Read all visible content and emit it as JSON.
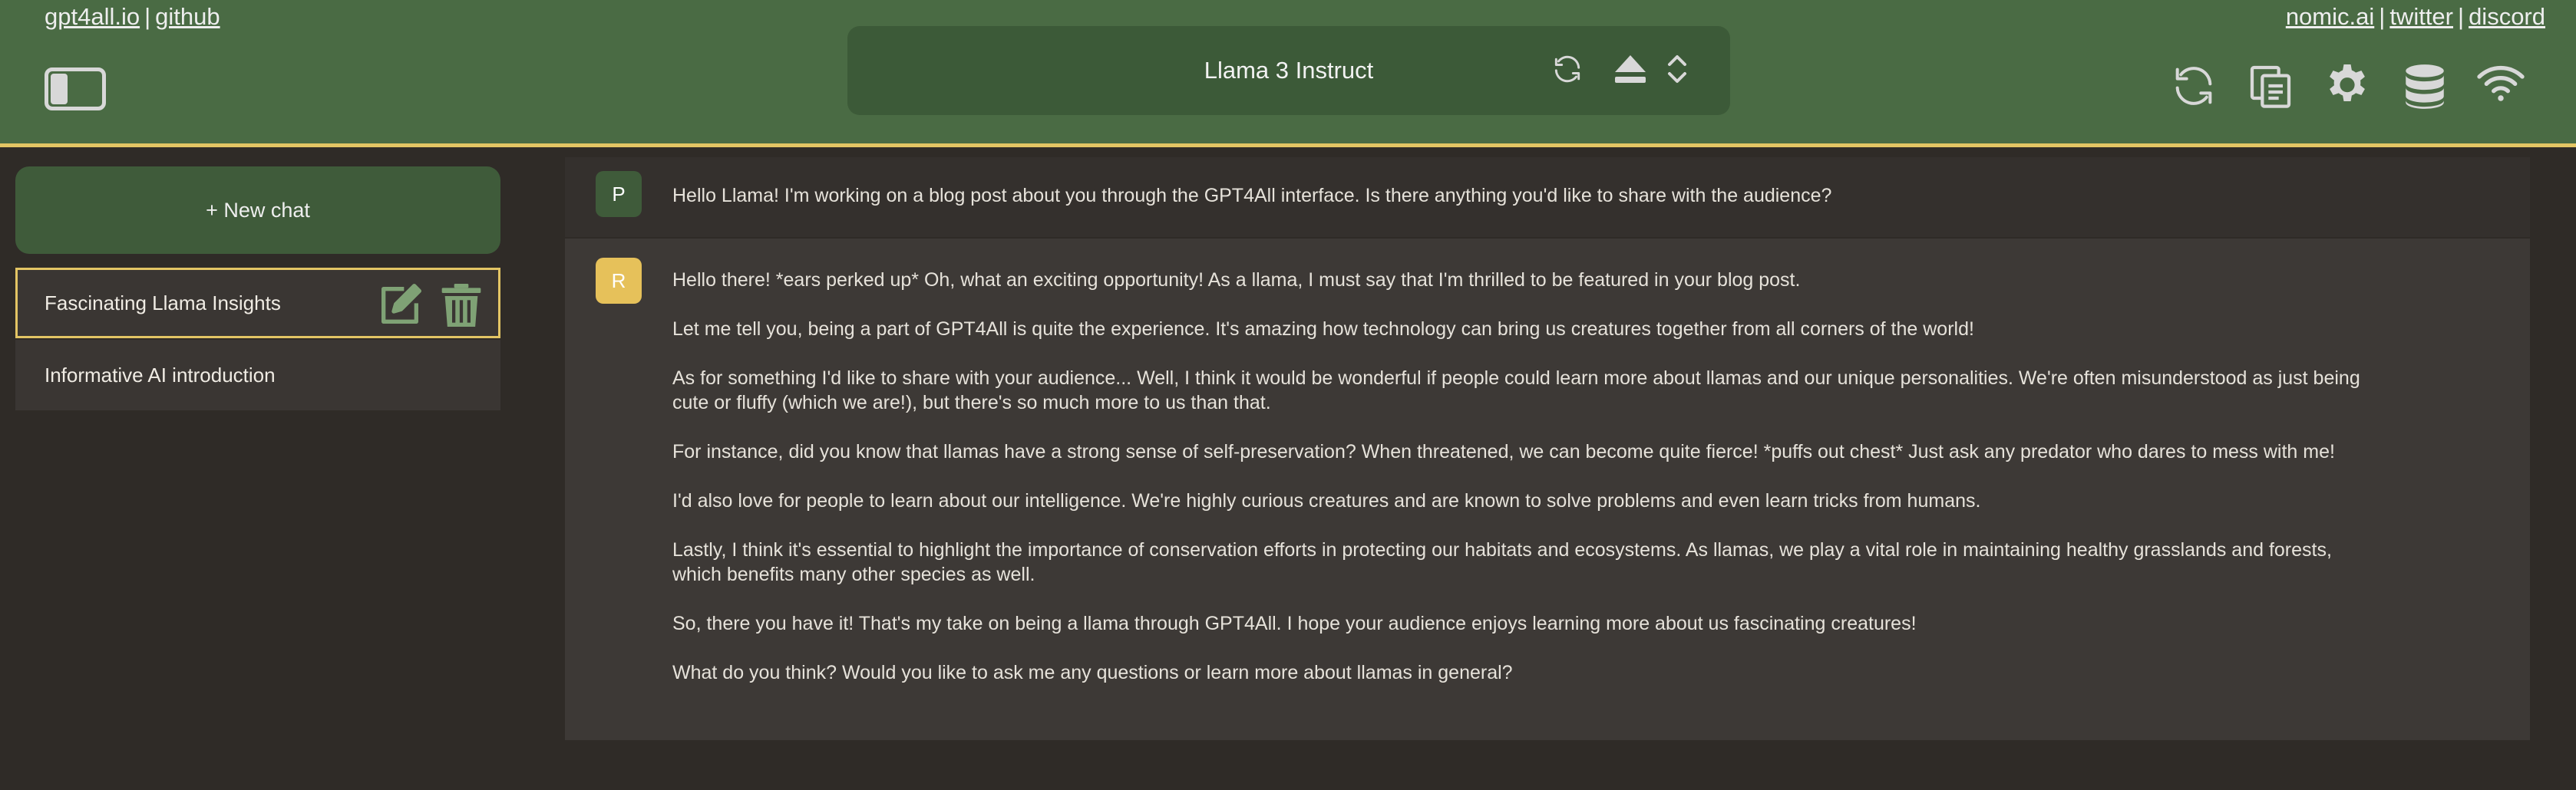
{
  "header": {
    "links_left": [
      "gpt4all.io",
      "github"
    ],
    "links_right": [
      "nomic.ai",
      "twitter",
      "discord"
    ],
    "separator": "|",
    "model_name": "Llama 3 Instruct",
    "model_icons": [
      "reload-model-icon",
      "eject-model-icon",
      "model-selector-chevron-icon"
    ],
    "toolbar_icons": [
      "refresh-icon",
      "copy-conversation-icon",
      "settings-gear-icon",
      "local-docs-database-icon",
      "network-wifi-icon"
    ]
  },
  "sidebar": {
    "new_chat_label": "+ New chat",
    "chats": [
      {
        "title": "Fascinating Llama Insights",
        "active": true
      },
      {
        "title": "Informative AI introduction",
        "active": false
      }
    ]
  },
  "conversation": {
    "prompt": {
      "avatar": "P",
      "text": "Hello Llama!  I'm working on a blog post about you through the GPT4All interface.  Is there anything you'd like to share with the audience?"
    },
    "response": {
      "avatar": "R",
      "paragraphs": [
        "Hello there! *ears perked up* Oh, what an exciting opportunity! As a llama, I must say that I'm thrilled to be featured in your blog post.",
        "Let me tell you, being a part of GPT4All is quite the experience. It's amazing how technology can bring us creatures together from all corners of the world!",
        "As for something I'd like to share with your audience... Well, I think it would be wonderful if people could learn more about llamas and our unique personalities. We're often misunderstood as just being cute or fluffy (which we are!), but there's so much more to us than that.",
        "For instance, did you know that llamas have a strong sense of self-preservation? When threatened, we can become quite fierce! *puffs out chest* Just ask any predator who dares to mess with me!",
        "I'd also love for people to learn about our intelligence. We're highly curious creatures and are known to solve problems and even learn tricks from humans.",
        "Lastly, I think it's essential to highlight the importance of conservation efforts in protecting our habitats and ecosystems. As llamas, we play a vital role in maintaining healthy grasslands and forests, which benefits many other species as well.",
        "So, there you have it! That's my take on being a llama through GPT4All. I hope your audience enjoys learning more about us fascinating creatures!",
        "What do you think? Would you like to ask me any questions or learn more about llamas in general?"
      ]
    }
  },
  "colors": {
    "header_bg": "#4a6b44",
    "accent": "#e3c564",
    "app_bg": "#2f2b27",
    "new_chat_bg": "#3f5b3a",
    "response_avatar": "#e6c15a"
  }
}
